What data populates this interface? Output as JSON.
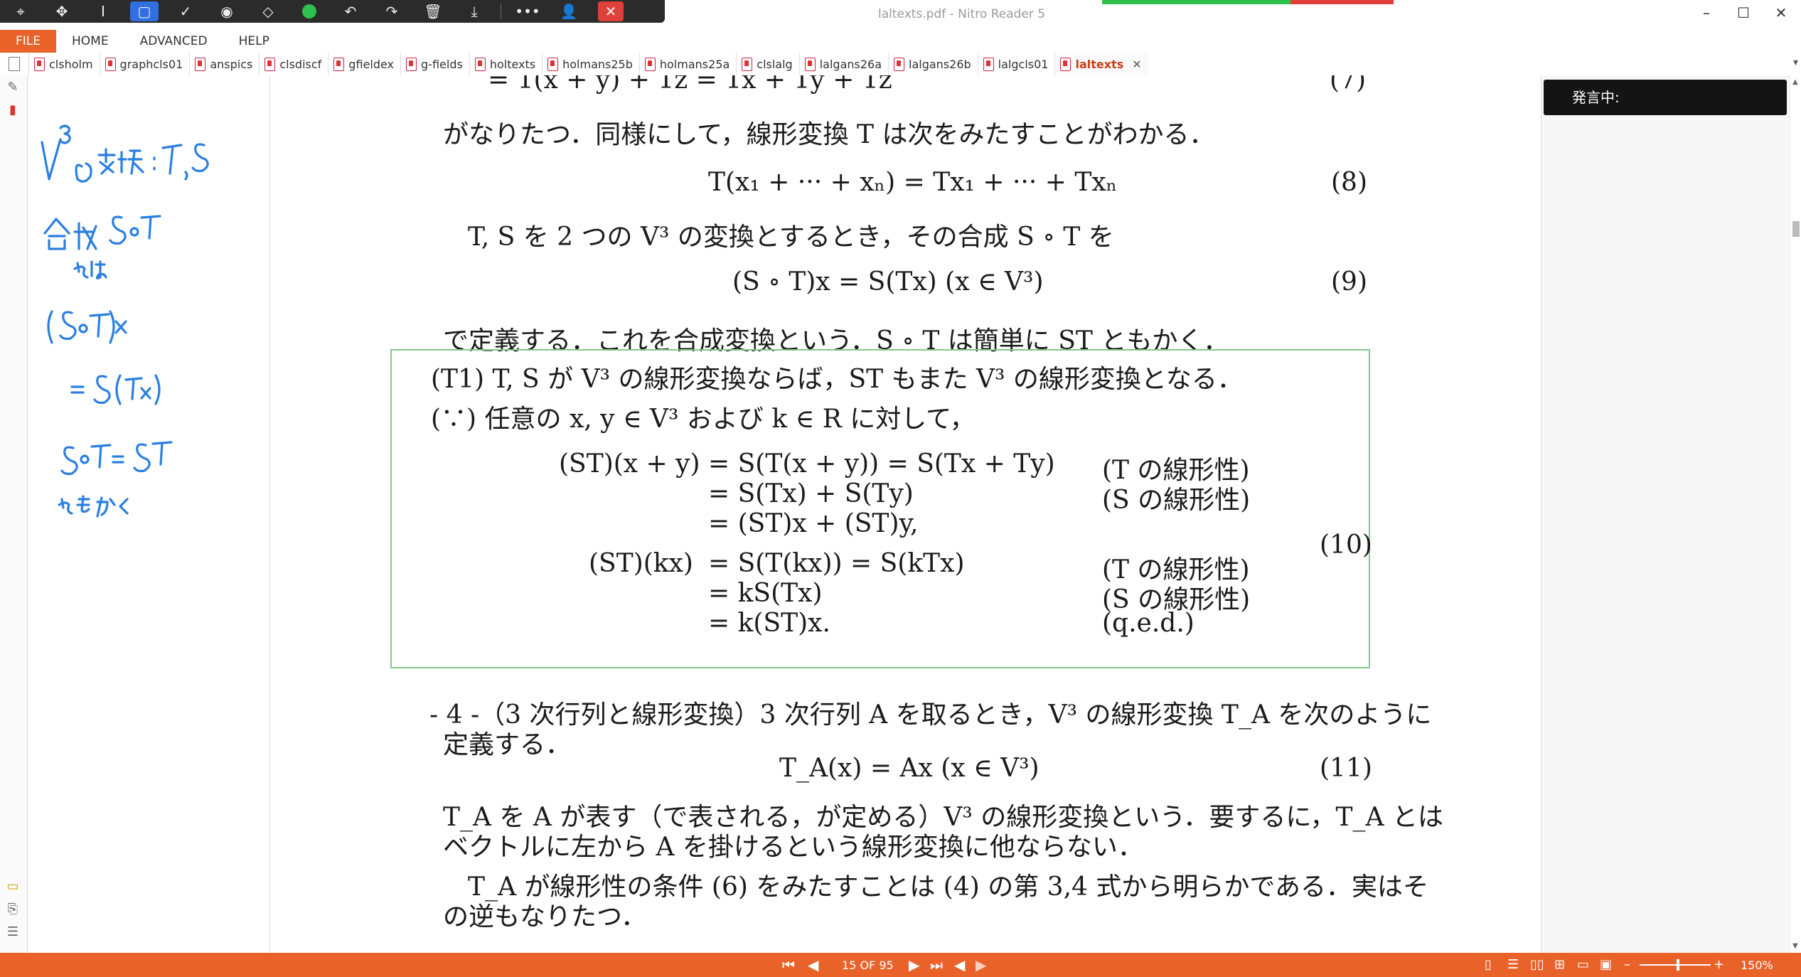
{
  "app": {
    "window_title": "laltexts.pdf - Nitro Reader 5",
    "colors": {
      "accent": "#e8622a",
      "proof_border": "#7dc98a",
      "rec_green": "#2ec14e",
      "rec_red": "#e0403a"
    }
  },
  "floating_toolbar": {
    "icons": [
      "select-icon",
      "move-icon",
      "text-cursor-icon",
      "rectangle-select-icon",
      "check-icon",
      "stamp-icon",
      "eraser-icon",
      "green-dot-icon",
      "undo-icon",
      "redo-icon",
      "trash-icon",
      "download-icon",
      "more-icon",
      "person-icon",
      "close-icon"
    ]
  },
  "menu": {
    "file": "FILE",
    "items": [
      "HOME",
      "ADVANCED",
      "HELP"
    ]
  },
  "tabs": [
    {
      "label": "clsholm"
    },
    {
      "label": "graphcls01"
    },
    {
      "label": "anspics"
    },
    {
      "label": "clsdiscf"
    },
    {
      "label": "gfieldex"
    },
    {
      "label": "g-fields"
    },
    {
      "label": "holtexts"
    },
    {
      "label": "holmans25b"
    },
    {
      "label": "holmans25a"
    },
    {
      "label": "clslalg"
    },
    {
      "label": "lalgans26a"
    },
    {
      "label": "lalgans26b"
    },
    {
      "label": "lalgcls01"
    },
    {
      "label": "laltexts",
      "active": true
    }
  ],
  "handwritten_notes": [
    "V³の変換：T, S",
    "合成 S∘T とは",
    "(S∘T)x",
    "= S(Tx)",
    "S∘T = ST",
    "ともかく"
  ],
  "document": {
    "top_cut": "=   1(x + y) + 1z = 1x + 1y + 1z",
    "top_cut_num": "(7)",
    "p1": "がなりたつ．同様にして，線形変換 T は次をみたすことがわかる．",
    "eq8": "T(x₁ + ··· + xₙ) = Tx₁ + ··· + Txₙ",
    "eq8_num": "(8)",
    "p2": "T, S を 2 つの V³ の変換とするとき，その合成 S ∘ T を",
    "eq9": "(S ∘ T)x = S(Tx)        (x ∈ V³)",
    "eq9_num": "(9)",
    "p3": "で定義する．これを合成変換という．S ∘ T は簡単に ST ともかく．",
    "proof": {
      "t1": "(T1)  T, S が V³ の線形変換ならば，ST もまた V³ の線形変換となる．",
      "because": "(∵)  任意の x, y ∈ V³ および k ∈ R に対して，",
      "lhs1": "(ST)(x + y)",
      "lhs2": "(ST)(kx)",
      "rows": [
        {
          "rhs": "= S(T(x + y)) = S(Tx + Ty)",
          "note": "(T の線形性)"
        },
        {
          "rhs": "= S(Tx) + S(Ty)",
          "note": "(S の線形性)"
        },
        {
          "rhs": "= (ST)x + (ST)y,",
          "note": ""
        },
        {
          "rhs": "= S(T(kx)) = S(kTx)",
          "note": "(T の線形性)"
        },
        {
          "rhs": "= kS(Tx)",
          "note": "(S の線形性)"
        },
        {
          "rhs": "= k(ST)x.",
          "note": "(q.e.d.)"
        }
      ],
      "num": "(10)"
    },
    "s4_line1": "- 4 -（3 次行列と線形変換）3 次行列 A を取るとき，V³ の線形変換 T_A を次のように",
    "s4_line2": "定義する．",
    "eq11": "T_A(x) = Ax    (x ∈ V³)",
    "eq11_num": "(11)",
    "p5_line1": "T_A を A が表す（で表される，が定める）V³ の線形変換という．要するに，T_A とは",
    "p5_line2": "ベクトルに左から A を掛けるという線形変換に他ならない．",
    "p6_line1": "T_A が線形性の条件 (6) をみたすことは (4) の第 3,4 式から明らかである．実はそ",
    "p6_line2": "の逆もなりたつ．"
  },
  "right_panel": {
    "speech_label": "発言中:"
  },
  "status": {
    "page_label": "15 OF 95",
    "zoom": "150%"
  }
}
